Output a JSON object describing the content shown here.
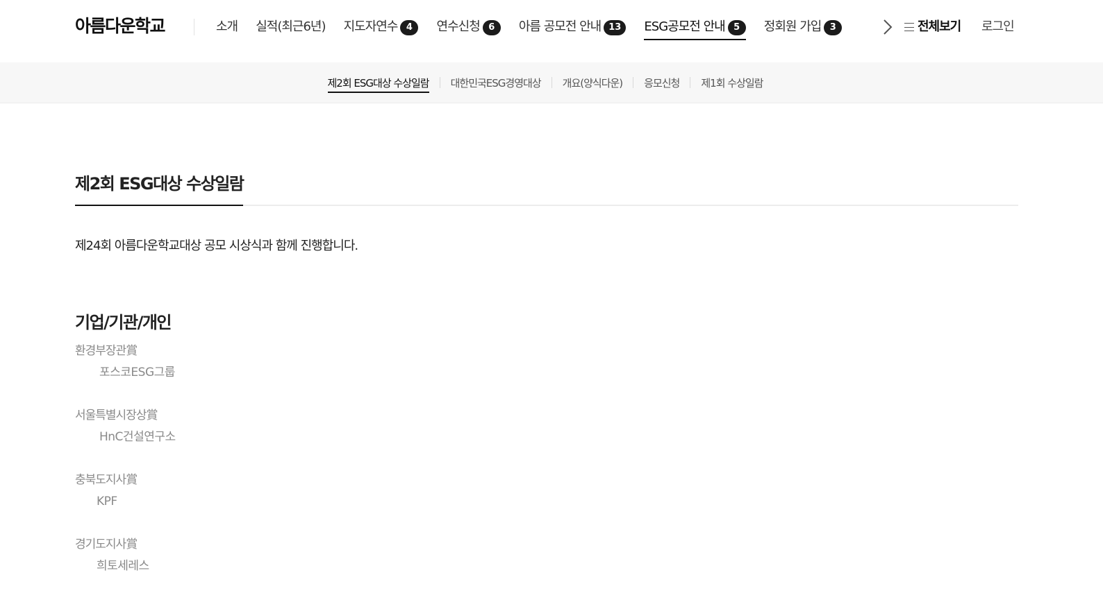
{
  "header": {
    "logo": "아름다운학교",
    "gnb": [
      {
        "label": "소개",
        "badge": null,
        "active": false
      },
      {
        "label": "실적(최근6년)",
        "badge": null,
        "active": false
      },
      {
        "label": "지도자연수",
        "badge": "4",
        "active": false
      },
      {
        "label": "연수신청",
        "badge": "6",
        "active": false
      },
      {
        "label": "아름 공모전 안내",
        "badge": "13",
        "active": false
      },
      {
        "label": "ESG공모전 안내",
        "badge": "5",
        "active": true
      },
      {
        "label": "정회원 가입",
        "badge": "3",
        "active": false
      }
    ],
    "next_icon": "chevron-right-icon",
    "all_menu_label": "전체보기",
    "login_label": "로그인"
  },
  "subnav": [
    {
      "label": "제2회 ESG대상 수상일람",
      "active": true
    },
    {
      "label": "대한민국ESG경영대상",
      "active": false
    },
    {
      "label": "개요(양식다운)",
      "active": false
    },
    {
      "label": "응모신청",
      "active": false
    },
    {
      "label": "제1회 수상일람",
      "active": false
    }
  ],
  "main": {
    "page_title": "제2회 ESG대상 수상일람",
    "intro": "제24회 아름다운학교대상 공모 시상식과 함께 진행합니다.",
    "section_title": "기업/기관/개인",
    "awards": [
      {
        "name": "환경부장관賞",
        "winner": "포스코ESG그룹"
      },
      {
        "name": "서울특별시장상賞",
        "winner": "HnC건설연구소"
      },
      {
        "name": "충북도지사賞",
        "winner": "KPF"
      },
      {
        "name": "경기도지사賞",
        "winner": "희토세레스"
      }
    ]
  },
  "colors": {
    "badge_bg": "#1b1b1b",
    "subnav_bg": "#f7f7f7",
    "award_text": "#8a8a8a"
  }
}
